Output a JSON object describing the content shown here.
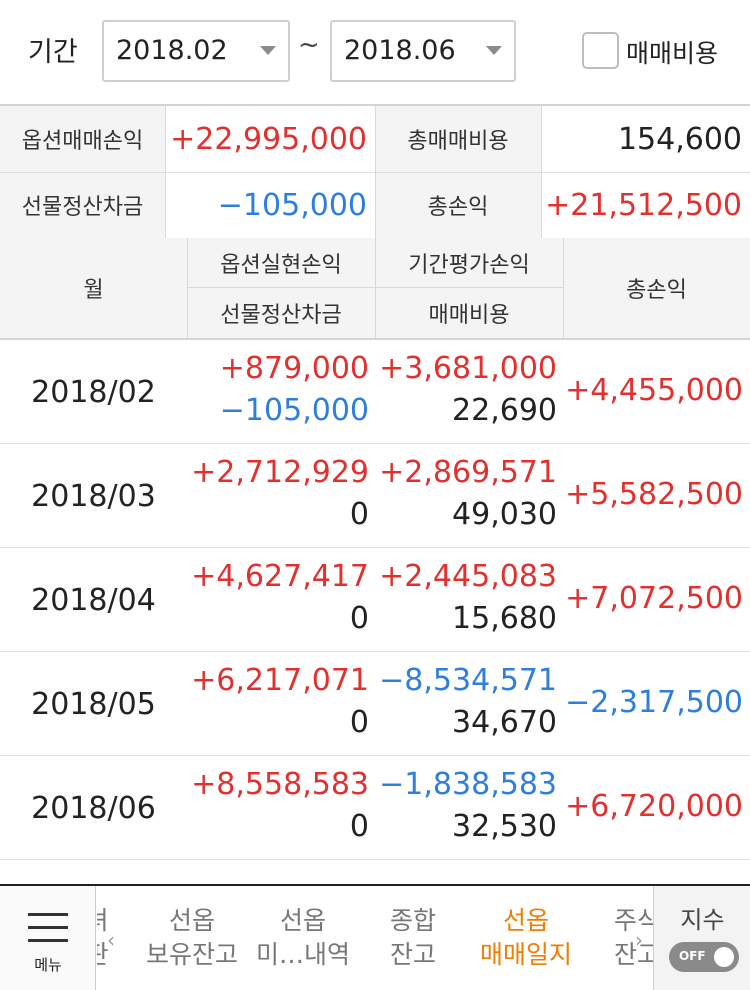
{
  "filter": {
    "period_label": "기간",
    "start": "2018.02",
    "separator": "~",
    "end": "2018.06",
    "trade_cost_checkbox_label": "매매비용",
    "trade_cost_checked": false
  },
  "summary": {
    "option_pl_label": "옵션매매손익",
    "option_pl_value": "+22,995,000",
    "total_cost_label": "총매매비용",
    "total_cost_value": "154,600",
    "futures_settle_label": "선물정산차금",
    "futures_settle_value": "−105,000",
    "total_pl_label": "총손익",
    "total_pl_value": "+21,512,500"
  },
  "table": {
    "headers": {
      "month": "월",
      "realized_pl": "옵션실현손익",
      "futures_settle": "선물정산차금",
      "period_eval_pl": "기간평가손익",
      "trade_cost": "매매비용",
      "total_pl": "총손익"
    },
    "rows": [
      {
        "month": "2018/02",
        "realized": "+879,000",
        "futures": "−105,000",
        "eval": "+3,681,000",
        "cost": "22,690",
        "total": "+4,455,000"
      },
      {
        "month": "2018/03",
        "realized": "+2,712,929",
        "futures": "0",
        "eval": "+2,869,571",
        "cost": "49,030",
        "total": "+5,582,500"
      },
      {
        "month": "2018/04",
        "realized": "+4,627,417",
        "futures": "0",
        "eval": "+2,445,083",
        "cost": "15,680",
        "total": "+7,072,500"
      },
      {
        "month": "2018/05",
        "realized": "+6,217,071",
        "futures": "0",
        "eval": "−8,534,571",
        "cost": "34,670",
        "total": "−2,317,500"
      },
      {
        "month": "2018/06",
        "realized": "+8,558,583",
        "futures": "0",
        "eval": "−1,838,583",
        "cost": "32,530",
        "total": "+6,720,000"
      }
    ]
  },
  "bottom_nav": {
    "menu_label": "메뉴",
    "tabs": [
      {
        "line1": "녀",
        "line2": "판"
      },
      {
        "line1": "선옵",
        "line2": "보유잔고"
      },
      {
        "line1": "선옵",
        "line2": "미…내역"
      },
      {
        "line1": "종합",
        "line2": "잔고"
      },
      {
        "line1": "선옵",
        "line2": "매매일지"
      },
      {
        "line1": "주식",
        "line2": "잔고"
      }
    ],
    "index_label": "지수",
    "index_toggle": "OFF"
  },
  "colors": {
    "positive": "#e2302e",
    "negative": "#2e7ee0",
    "active_tab": "#f07c00"
  }
}
